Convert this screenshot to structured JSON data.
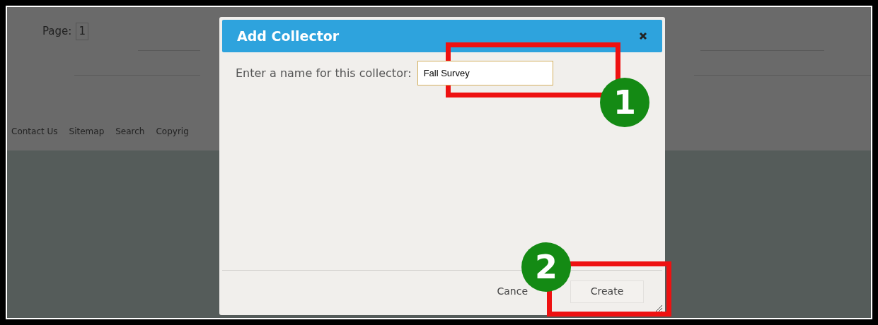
{
  "page": {
    "pager_label": "Page:",
    "pager_current": "1",
    "footer_links": [
      "Contact Us",
      "Sitemap",
      "Search",
      "Copyrig"
    ]
  },
  "dialog": {
    "title": "Add Collector",
    "prompt": "Enter a name for this collector:",
    "name_value": "Fall Survey",
    "buttons": [
      {
        "kind": "cancel",
        "label": "Cance"
      },
      {
        "kind": "create",
        "label": "Create"
      }
    ]
  },
  "annotations": [
    {
      "number": "1"
    },
    {
      "number": "2"
    }
  ]
}
